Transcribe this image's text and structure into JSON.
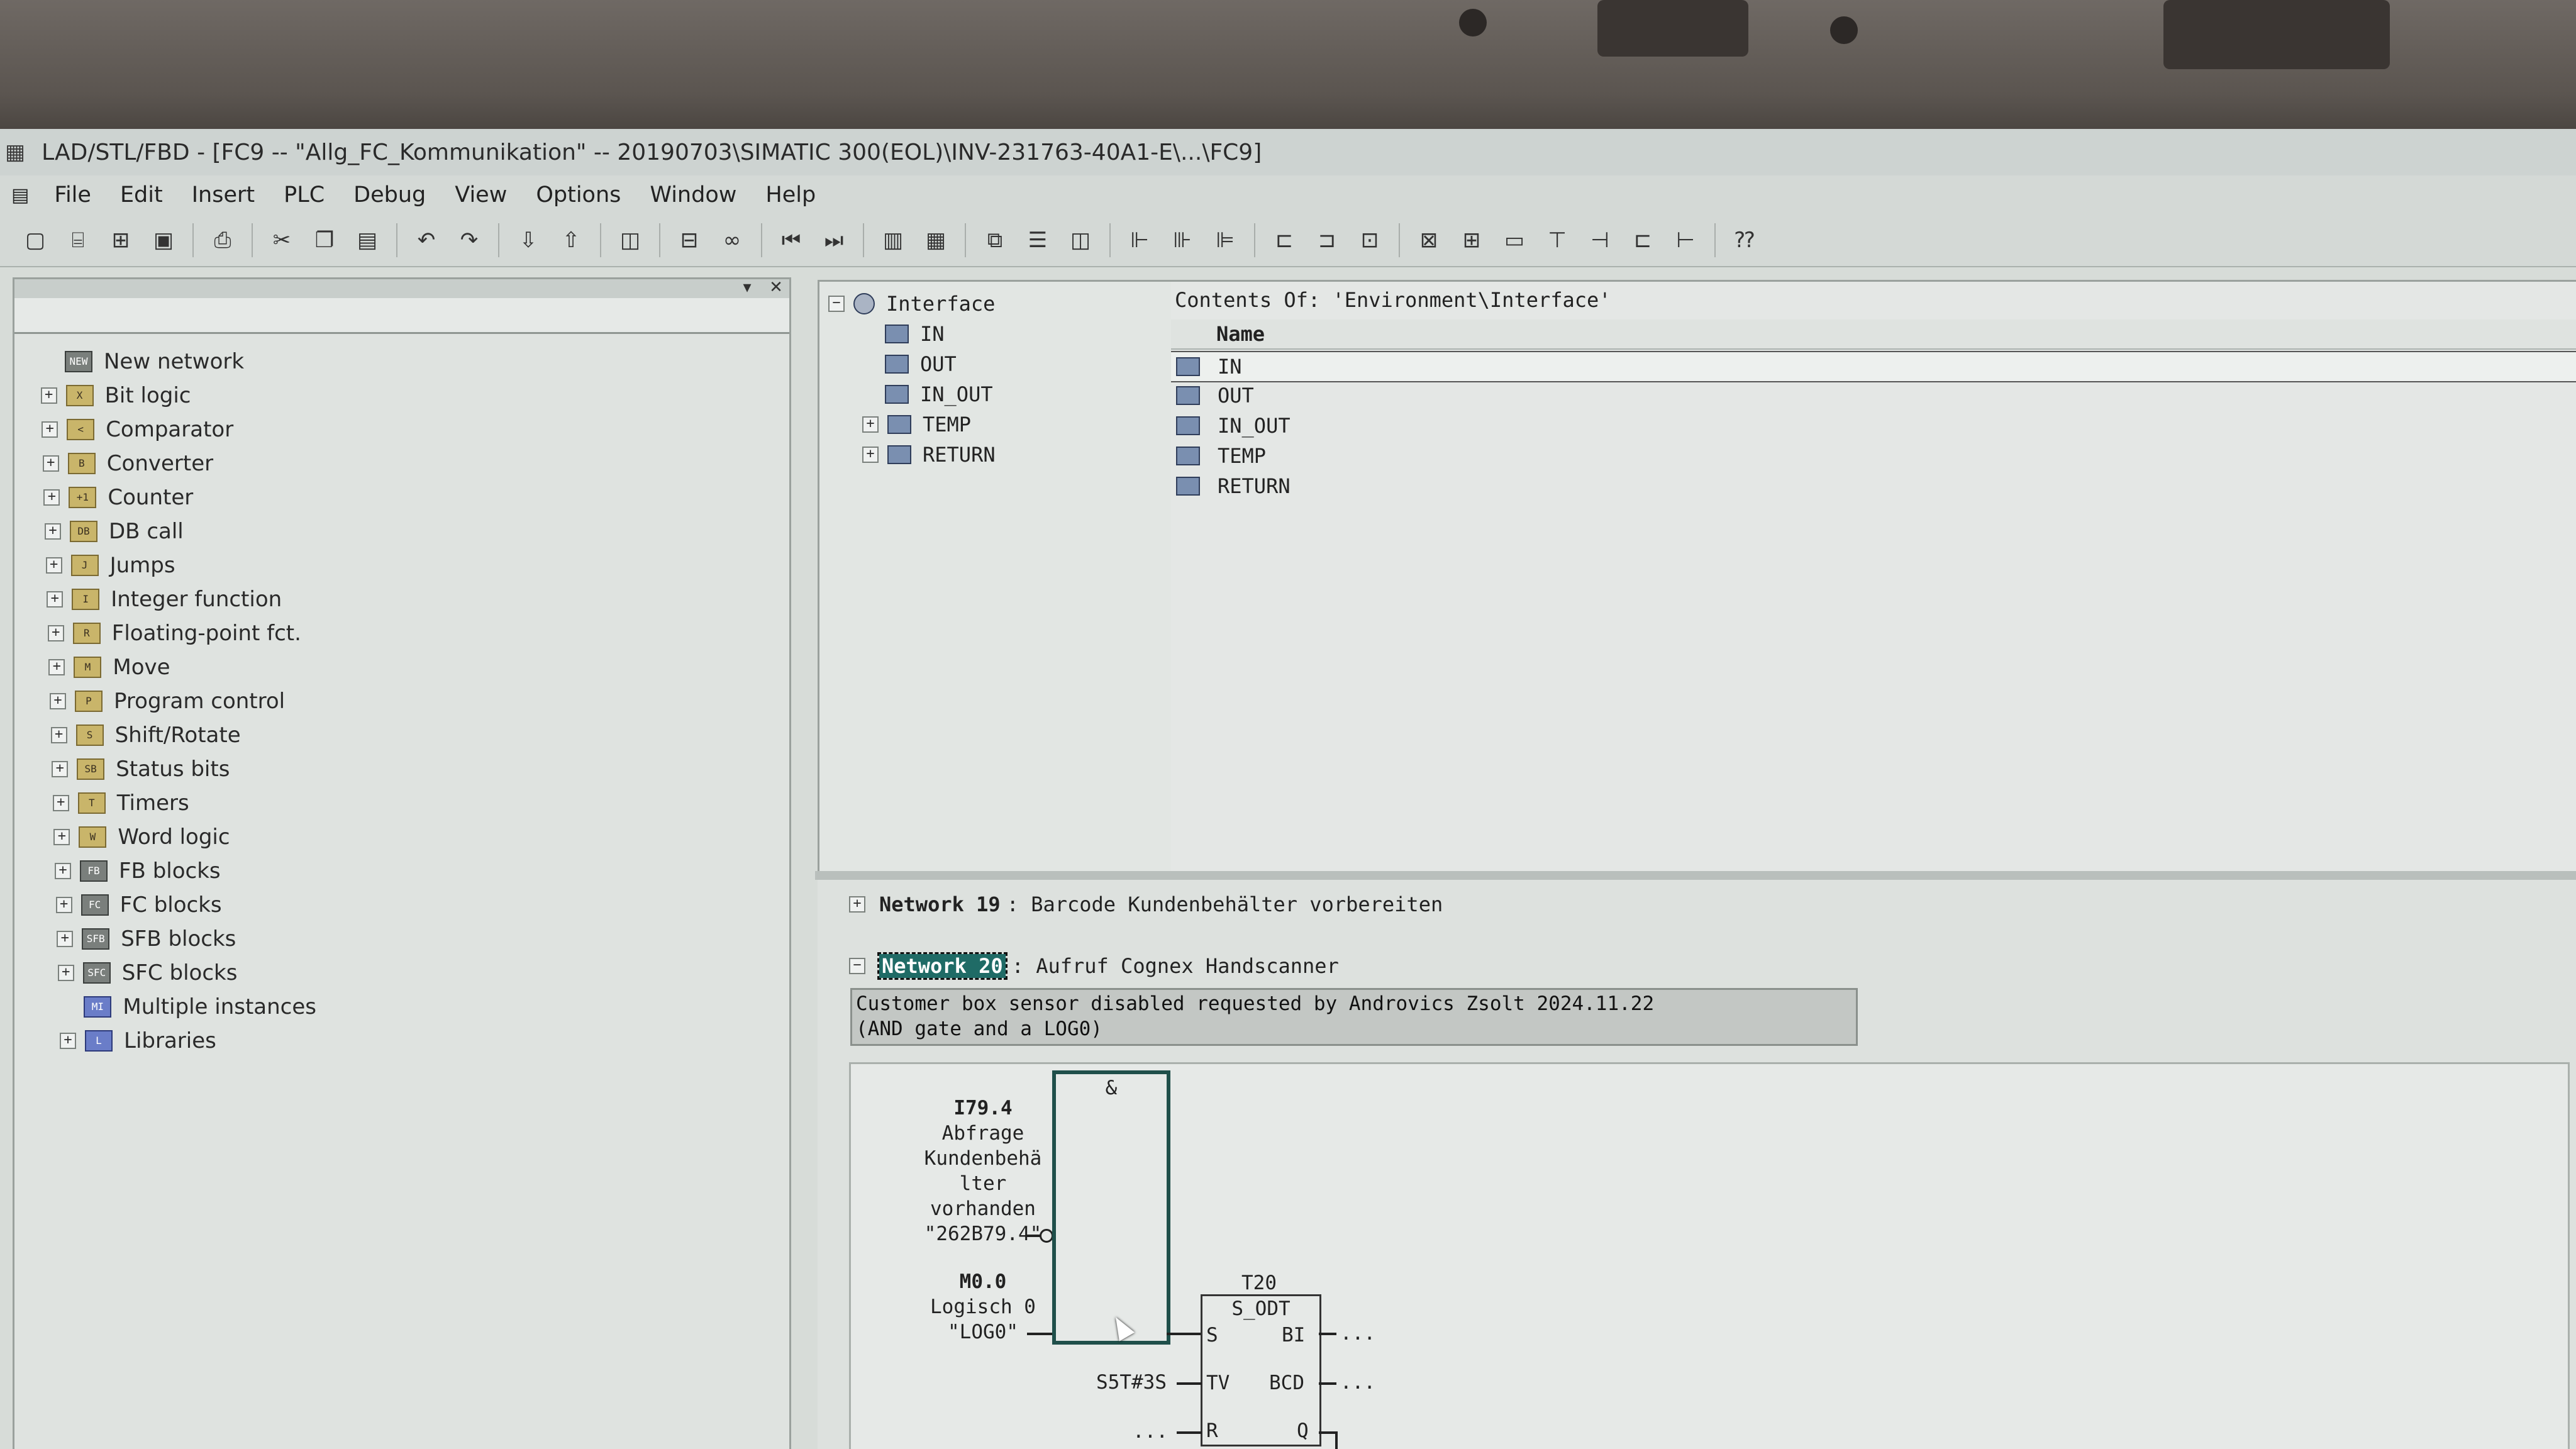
{
  "window": {
    "title": "LAD/STL/FBD  - [FC9 -- \"Allg_FC_Kommunikation\" -- 20190703\\SIMATIC 300(EOL)\\INV-231763-40A1-E\\...\\FC9]"
  },
  "menu": [
    "File",
    "Edit",
    "Insert",
    "PLC",
    "Debug",
    "View",
    "Options",
    "Window",
    "Help"
  ],
  "toolbar_icons": [
    "new-icon",
    "open-icon",
    "accessible-nodes-icon",
    "save-icon",
    "print-icon",
    "cut-icon",
    "copy-icon",
    "paste-icon",
    "undo-icon",
    "redo-icon",
    "download-icon",
    "upload-icon",
    "monitor-icon",
    "module-info-icon",
    "glasses-icon",
    "first-icon",
    "last-icon",
    "overview-icon",
    "details-icon",
    "network-icon",
    "window-1-icon",
    "window-2-icon",
    "contact-icon",
    "contact-list-icon",
    "coil-icon",
    "box-icon",
    "branch-icon",
    "and-icon",
    "or-icon",
    "assign-icon",
    "sr-icon",
    "open-branch-icon",
    "close-branch-icon",
    "help-icon"
  ],
  "catalog": {
    "items": [
      {
        "label": "New network",
        "icon": "NEW",
        "expand": false
      },
      {
        "label": "Bit logic",
        "icon": "X",
        "expand": true
      },
      {
        "label": "Comparator",
        "icon": "<",
        "expand": true
      },
      {
        "label": "Converter",
        "icon": "B",
        "expand": true
      },
      {
        "label": "Counter",
        "icon": "+1",
        "expand": true
      },
      {
        "label": "DB call",
        "icon": "DB",
        "expand": true
      },
      {
        "label": "Jumps",
        "icon": "J",
        "expand": true
      },
      {
        "label": "Integer function",
        "icon": "I",
        "expand": true
      },
      {
        "label": "Floating-point fct.",
        "icon": "R",
        "expand": true
      },
      {
        "label": "Move",
        "icon": "M",
        "expand": true
      },
      {
        "label": "Program control",
        "icon": "P",
        "expand": true
      },
      {
        "label": "Shift/Rotate",
        "icon": "S",
        "expand": true
      },
      {
        "label": "Status bits",
        "icon": "SB",
        "expand": true
      },
      {
        "label": "Timers",
        "icon": "T",
        "expand": true
      },
      {
        "label": "Word logic",
        "icon": "W",
        "expand": true
      },
      {
        "label": "FB blocks",
        "icon": "FB",
        "expand": true
      },
      {
        "label": "FC blocks",
        "icon": "FC",
        "expand": true
      },
      {
        "label": "SFB blocks",
        "icon": "SFB",
        "expand": true
      },
      {
        "label": "SFC blocks",
        "icon": "SFC",
        "expand": true
      },
      {
        "label": "Multiple instances",
        "icon": "MI",
        "expand": false
      },
      {
        "label": "Libraries",
        "icon": "L",
        "expand": true
      }
    ]
  },
  "interface_tree": {
    "root": "Interface",
    "children": [
      "IN",
      "OUT",
      "IN_OUT",
      "TEMP",
      "RETURN"
    ]
  },
  "contents": {
    "title": "Contents Of: 'Environment\\Interface'",
    "column": "Name",
    "rows": [
      "IN",
      "OUT",
      "IN_OUT",
      "TEMP",
      "RETURN"
    ]
  },
  "networks": {
    "net19": {
      "label": "Network 19",
      "title": ": Barcode Kundenbehälter vorbereiten"
    },
    "net20": {
      "label": "Network 20",
      "title": ": Aufruf Cognex Handscanner"
    },
    "comment_line1": "Customer box sensor disabled requested by Androvics Zsolt 2024.11.22",
    "comment_line2": "(AND gate and a LOG0)"
  },
  "ladder": {
    "and_symbol": "&",
    "input1": {
      "addr": "I79.4",
      "c1": "Abfrage",
      "c2": "Kundenbehä",
      "c3": "lter",
      "c4": "vorhanden",
      "sym": "\"262B79.4\""
    },
    "input2": {
      "addr": "M0.0",
      "c1": "Logisch 0",
      "sym": "\"LOG0\""
    },
    "timer": {
      "name": "T20",
      "type": "S_ODT",
      "s": "S",
      "bi": "BI",
      "tv": "TV",
      "bcd": "BCD",
      "r": "R",
      "q": "Q",
      "tv_value": "S5T#3S",
      "dots": "..."
    }
  }
}
